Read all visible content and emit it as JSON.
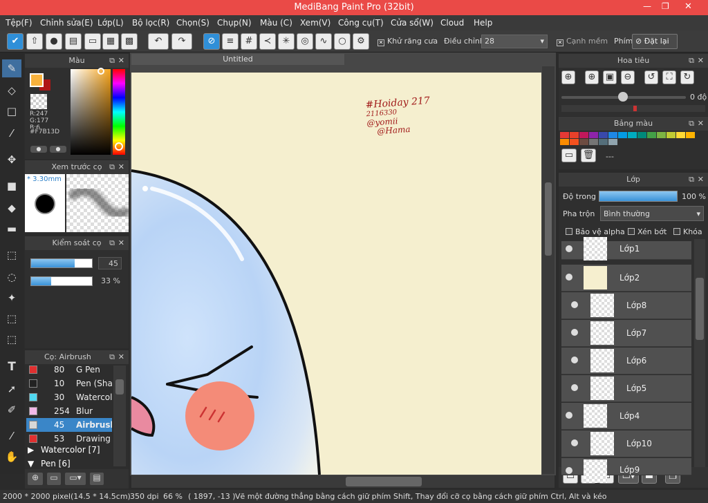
{
  "window": {
    "title": "MediBang Paint Pro (32bit)"
  },
  "menu": [
    "Tệp(F)",
    "Chỉnh sửa(E)",
    "Lớp(L)",
    "Bộ lọc(R)",
    "Chọn(S)",
    "Chụp(N)",
    "Màu (C)",
    "Xem(V)",
    "Công cụ(T)",
    "Cửa sổ(W)",
    "Cloud",
    "Help"
  ],
  "toolbar": {
    "antialias_label": "Khử răng cưa",
    "adjust_label": "Điều chỉnh",
    "adjust_value": "28",
    "soft_edge_label": "Cạnh mềm",
    "key_label": "Phím",
    "reset_label": "Đặt lại"
  },
  "color_panel": {
    "title": "Màu",
    "r": "R:247",
    "g": "G:177",
    "b": "B:6...",
    "hex": "#F7B13D",
    "primary": "#f7b13d",
    "secondary": "#b01515"
  },
  "brush_preview": {
    "title": "Xem trước cọ",
    "size": "* 3.30mm"
  },
  "brush_control": {
    "title": "Kiểm soát cọ",
    "size_value": "45",
    "opacity_value": "33 %",
    "size_fill": 0.72,
    "opacity_fill": 0.33
  },
  "brush_list": {
    "title": "Cọ: Airbrush",
    "items": [
      {
        "size": "80",
        "name": "G Pen",
        "color": "#e03030"
      },
      {
        "size": "10",
        "name": "Pen (Sharp)",
        "color": "#222222"
      },
      {
        "size": "30",
        "name": "Watercolor",
        "color": "#50d8f0"
      },
      {
        "size": "254",
        "name": "Blur",
        "color": "#f2b8e8"
      },
      {
        "size": "45",
        "name": "Airbrush",
        "color": "#d8d8d8",
        "selected": true
      },
      {
        "size": "53",
        "name": "Drawing P",
        "color": "#e03030"
      }
    ],
    "groups": [
      "Watercolor [7]",
      "Pen [6]"
    ]
  },
  "canvas": {
    "tab": "Untitled",
    "signature": [
      "#Hoiday 217",
      "2116330",
      "@yomii",
      "@Hama"
    ]
  },
  "navigator": {
    "title": "Hoa tiêu",
    "angle": "0 độ"
  },
  "palette": {
    "title": "Bảng màu",
    "empty": "---",
    "colors": [
      "#e53935",
      "#e8402a",
      "#c2185b",
      "#8e24aa",
      "#3949ab",
      "#1e88e5",
      "#039be5",
      "#00acc1",
      "#00897b",
      "#43a047",
      "#7cb342",
      "#c0ca33",
      "#fdd835",
      "#ffb300",
      "#fb8c00",
      "#f4511e",
      "#6d4c41",
      "#757575",
      "#546e7a",
      "#90a4ae"
    ]
  },
  "layers": {
    "title": "Lớp",
    "opacity_label": "Độ trong",
    "opacity_value": "100 %",
    "blend_label": "Pha trộn",
    "blend_value": "Bình thường",
    "protect_alpha": "Bảo vệ alpha",
    "clip": "Xén bớt",
    "lock": "Khóa",
    "items": [
      {
        "name": "Lớp1",
        "indent": false
      },
      {
        "name": "Lớp2",
        "indent": false
      },
      {
        "name": "Lớp8",
        "indent": true
      },
      {
        "name": "Lớp7",
        "indent": true
      },
      {
        "name": "Lớp6",
        "indent": true
      },
      {
        "name": "Lớp5",
        "indent": true
      },
      {
        "name": "Lớp4",
        "indent": false
      },
      {
        "name": "Lớp10",
        "indent": true
      },
      {
        "name": "Lớp9",
        "indent": false
      }
    ]
  },
  "status": {
    "size": "2000 * 2000 pixel",
    "cm": "(14.5 * 14.5cm)",
    "dpi": "350 dpi",
    "zoom": "66 %",
    "coords": "( 1897, -13 )",
    "hint": "Vẽ một đường thẳng bằng cách giữ phím Shift, Thay đổi cỡ cọ bằng cách giữ phím Ctrl, Alt và kéo"
  }
}
